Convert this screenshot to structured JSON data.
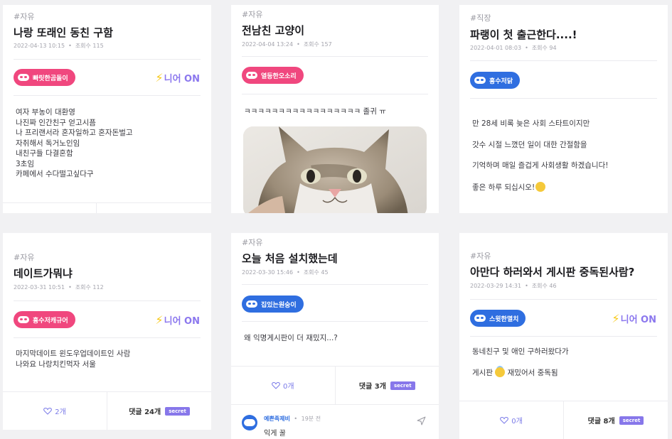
{
  "cards": [
    {
      "tag": "#자유",
      "title": "나랑 또래인 동친 구함",
      "date": "2022-04-13 10:15",
      "views": "조회수 115",
      "badge": "빠릿한곰돌이",
      "badge_color": "pink",
      "nion": "니어 ON",
      "body": [
        "여자 부농이 대환영",
        "나진짜 인간친구 얻고시픔",
        "나 프리랜서라 혼자일하고 혼자돈벌고",
        "자취해서 독거노인임",
        "내친구들 다결혼함",
        "3초임",
        "카페에서 수다떨고싶다구"
      ]
    },
    {
      "tag": "#자유",
      "title": "전남친 고양이",
      "date": "2022-04-04 13:24",
      "views": "조회수 157",
      "badge": "열등한오소리",
      "badge_color": "pink",
      "body": [
        "ㅋㅋㅋㅋㅋㅋㅋㅋㅋㅋㅋㅋㅋㅋㅋㅋㅋ 졸귀 ㅠ"
      ]
    },
    {
      "tag": "#직장",
      "title": "파랭이 첫 출근한다....!",
      "date": "2022-04-01 08:03",
      "views": "조회수 94",
      "badge": "흉수저닭",
      "badge_color": "blue",
      "body": [
        "만 28세 비록 늦은 사회 스타트이지만",
        "갓수 시절 느꼈던 일이 대한 간절함을",
        "기억하며 매일 즐겁게 사회생활 하겠습니다!",
        "좋은 하루 되십시오!"
      ]
    },
    {
      "tag": "#자유",
      "title": "데이트가뭐냐",
      "date": "2022-03-31 10:51",
      "views": "조회수 112",
      "badge": "흉수저캐규어",
      "badge_color": "pink",
      "nion": "니어 ON",
      "body": [
        "마지막데이트 윈도우업데이트인 사람",
        "나와요 나랑치킨먹자 서울"
      ],
      "likes": "2개",
      "comments": "댓글 24개",
      "secret": "secret"
    },
    {
      "tag": "#자유",
      "title": "오늘 처음 설치했는데",
      "date": "2022-03-30 15:46",
      "views": "조회수 45",
      "badge": "집있는원숭이",
      "badge_color": "blue",
      "body": [
        "왜 익명게시판이 더 재밌지...?"
      ],
      "likes": "0개",
      "comments": "댓글 3개",
      "secret": "secret",
      "reply_author": "예쁜족제비",
      "reply_time": "19분 전",
      "reply_text": "익게 꿀"
    },
    {
      "tag": "#자유",
      "title": "아만다 하러와서 게시판 중독된사람?",
      "date": "2022-03-29 14:31",
      "views": "조회수 46",
      "badge": "스윗한멸치",
      "badge_color": "blue",
      "nion": "니어 ON",
      "body": [
        "동네친구 및 애인 구하러왔다가",
        "게시판",
        "재밌어서 중독됨"
      ],
      "likes": "0개",
      "comments": "댓글 8개",
      "secret": "secret"
    }
  ]
}
